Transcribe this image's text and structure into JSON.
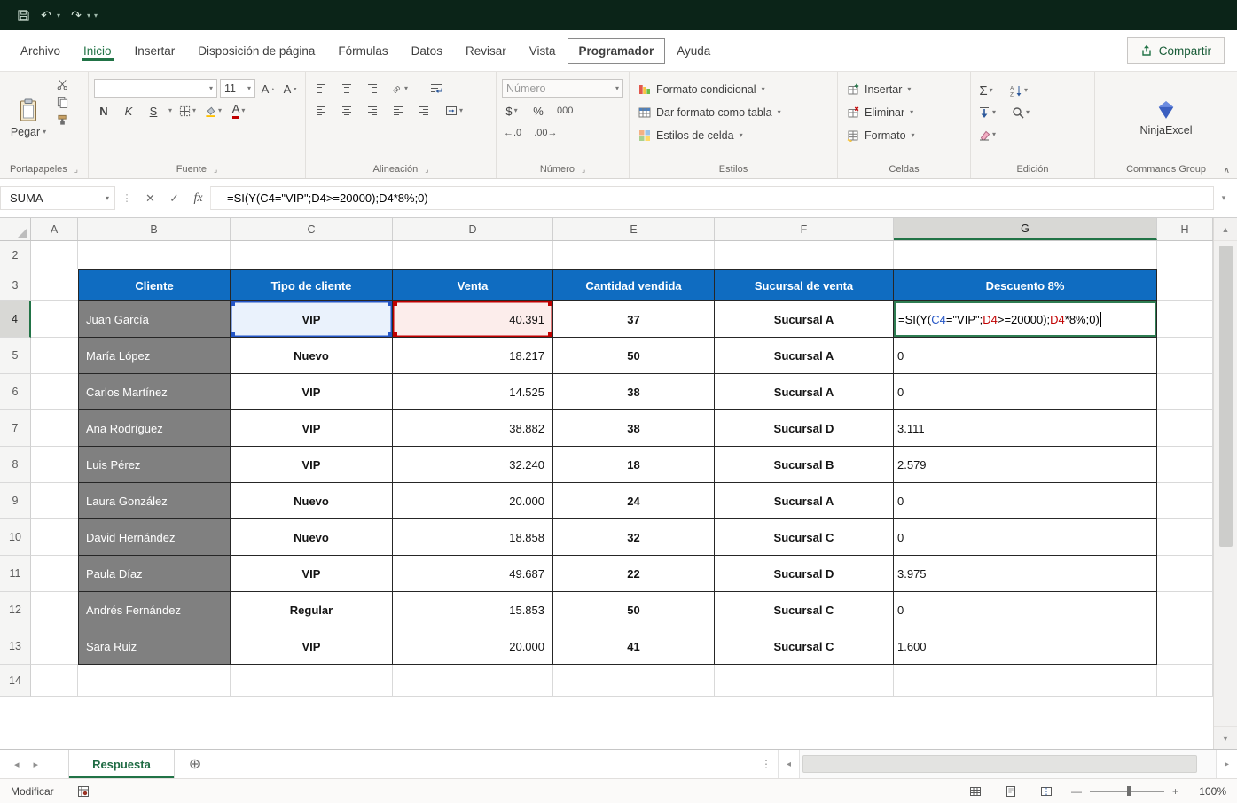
{
  "icons": {
    "chevron_down": "▾",
    "collapse_ribbon": "∧",
    "undo": "↶",
    "redo": "↷",
    "more": "▾",
    "cancel": "✕",
    "confirm": "✓",
    "scissors": "✂",
    "sigma": "Σ",
    "dialog_launcher": "⌟",
    "new_sheet": "⊕",
    "left_arrow": "◂",
    "right_arrow": "▸",
    "up_arrow": "▲",
    "down_arrow": "▼",
    "splitter": "⋮",
    "grow_font_mark": "▴",
    "shrink_font_mark": "▾",
    "increase_decimal": "←.0",
    "decrease_decimal": ".00→"
  },
  "colors": {
    "title_bar": "#0B2418",
    "accent_green": "#217346",
    "header_fill": "#0F6CC1",
    "client_fill": "#808080",
    "ref_blue": "#2456C6",
    "ref_red": "#C00000"
  },
  "ribbon": {
    "tabs": [
      "Archivo",
      "Inicio",
      "Insertar",
      "Disposición de página",
      "Fórmulas",
      "Datos",
      "Revisar",
      "Vista",
      "Programador",
      "Ayuda"
    ],
    "active_tab": "Inicio",
    "focused_tab": "Programador",
    "share_label": "Compartir",
    "clipboard": {
      "group_label": "Portapapeles",
      "paste_label": "Pegar"
    },
    "font": {
      "group_label": "Fuente",
      "size": "11",
      "bold": "N",
      "italic": "K",
      "underline": "S",
      "grow": "A",
      "shrink": "A",
      "color_letter": "A"
    },
    "alignment": {
      "group_label": "Alineación"
    },
    "number": {
      "group_label": "Número",
      "format_value": "Número",
      "currency": "$",
      "percent": "%",
      "thousands": "000"
    },
    "styles": {
      "group_label": "Estilos",
      "conditional": "Formato condicional",
      "format_table": "Dar formato como tabla",
      "cell_styles": "Estilos de celda"
    },
    "cells": {
      "group_label": "Celdas",
      "insert": "Insertar",
      "delete": "Eliminar",
      "format": "Formato"
    },
    "editing": {
      "group_label": "Edición"
    },
    "commands": {
      "group_label": "Commands Group",
      "addin": "NinjaExcel"
    }
  },
  "formula_bar": {
    "name_box": "SUMA",
    "fx": "fx",
    "formula": "=SI(Y(C4=\"VIP\";D4>=20000);D4*8%;0)"
  },
  "grid": {
    "column_headers": [
      "A",
      "B",
      "C",
      "D",
      "E",
      "F",
      "G",
      "H"
    ],
    "selected_column": "G",
    "row_labels": {
      "r2": "2",
      "r3": "3",
      "r14": "14"
    },
    "table": {
      "headers": {
        "cliente": "Cliente",
        "tipo": "Tipo de cliente",
        "venta": "Venta",
        "cantidad": "Cantidad vendida",
        "sucursal": "Sucursal de venta",
        "descuento": "Descuento 8%"
      },
      "rows": [
        {
          "row_num": "4",
          "cliente": "Juan García",
          "tipo": "VIP",
          "venta": "40.391",
          "cantidad": "37",
          "sucursal": "Sucursal A",
          "descuento": ""
        },
        {
          "row_num": "5",
          "cliente": "María López",
          "tipo": "Nuevo",
          "venta": "18.217",
          "cantidad": "50",
          "sucursal": "Sucursal A",
          "descuento": "0"
        },
        {
          "row_num": "6",
          "cliente": "Carlos Martínez",
          "tipo": "VIP",
          "venta": "14.525",
          "cantidad": "38",
          "sucursal": "Sucursal A",
          "descuento": "0"
        },
        {
          "row_num": "7",
          "cliente": "Ana Rodríguez",
          "tipo": "VIP",
          "venta": "38.882",
          "cantidad": "38",
          "sucursal": "Sucursal D",
          "descuento": "3.111"
        },
        {
          "row_num": "8",
          "cliente": "Luis Pérez",
          "tipo": "VIP",
          "venta": "32.240",
          "cantidad": "18",
          "sucursal": "Sucursal B",
          "descuento": "2.579"
        },
        {
          "row_num": "9",
          "cliente": "Laura González",
          "tipo": "Nuevo",
          "venta": "20.000",
          "cantidad": "24",
          "sucursal": "Sucursal A",
          "descuento": "0"
        },
        {
          "row_num": "10",
          "cliente": "David Hernández",
          "tipo": "Nuevo",
          "venta": "18.858",
          "cantidad": "32",
          "sucursal": "Sucursal C",
          "descuento": "0"
        },
        {
          "row_num": "11",
          "cliente": "Paula Díaz",
          "tipo": "VIP",
          "venta": "49.687",
          "cantidad": "22",
          "sucursal": "Sucursal D",
          "descuento": "3.975"
        },
        {
          "row_num": "12",
          "cliente": "Andrés Fernández",
          "tipo": "Regular",
          "venta": "15.853",
          "cantidad": "50",
          "sucursal": "Sucursal C",
          "descuento": "0"
        },
        {
          "row_num": "13",
          "cliente": "Sara Ruiz",
          "tipo": "VIP",
          "venta": "20.000",
          "cantidad": "41",
          "sucursal": "Sucursal C",
          "descuento": "1.600"
        }
      ]
    },
    "edit_cell": {
      "address": "G4",
      "parts": [
        {
          "text": "=SI(Y(",
          "color": "#000000"
        },
        {
          "text": "C4",
          "color": "#2456C6"
        },
        {
          "text": "=\"VIP\";",
          "color": "#000000"
        },
        {
          "text": "D4",
          "color": "#C00000"
        },
        {
          "text": ">=20000);",
          "color": "#000000"
        },
        {
          "text": "D4",
          "color": "#C00000"
        },
        {
          "text": "*8%;0)",
          "color": "#000000"
        }
      ]
    }
  },
  "sheet_bar": {
    "active_tab": "Respuesta"
  },
  "status_bar": {
    "mode": "Modificar",
    "zoom": "100%"
  }
}
